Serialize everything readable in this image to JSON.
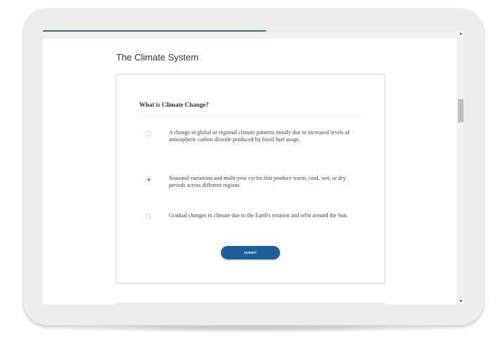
{
  "page": {
    "title": "The Climate System"
  },
  "progress": {
    "value": 0.53
  },
  "quiz": {
    "question": "What is Climate Change?",
    "options": [
      {
        "label": "A change in global or regional climate patterns mostly due to increased levels of atmospheric carbon dioxide produced by fossil fuel usage.",
        "selected": false
      },
      {
        "label": "Seasonal variations and multi-year cycles that produce warm, cool, wet, or dry periods across different regions",
        "selected": true
      },
      {
        "label": "Gradual changes in climate due to the Earth's rotation and orbit around the Sun.",
        "selected": false
      }
    ],
    "submit_label": "SUBMIT"
  },
  "colors": {
    "accent": "#1f5d97",
    "progress": "#2d6ca5"
  }
}
